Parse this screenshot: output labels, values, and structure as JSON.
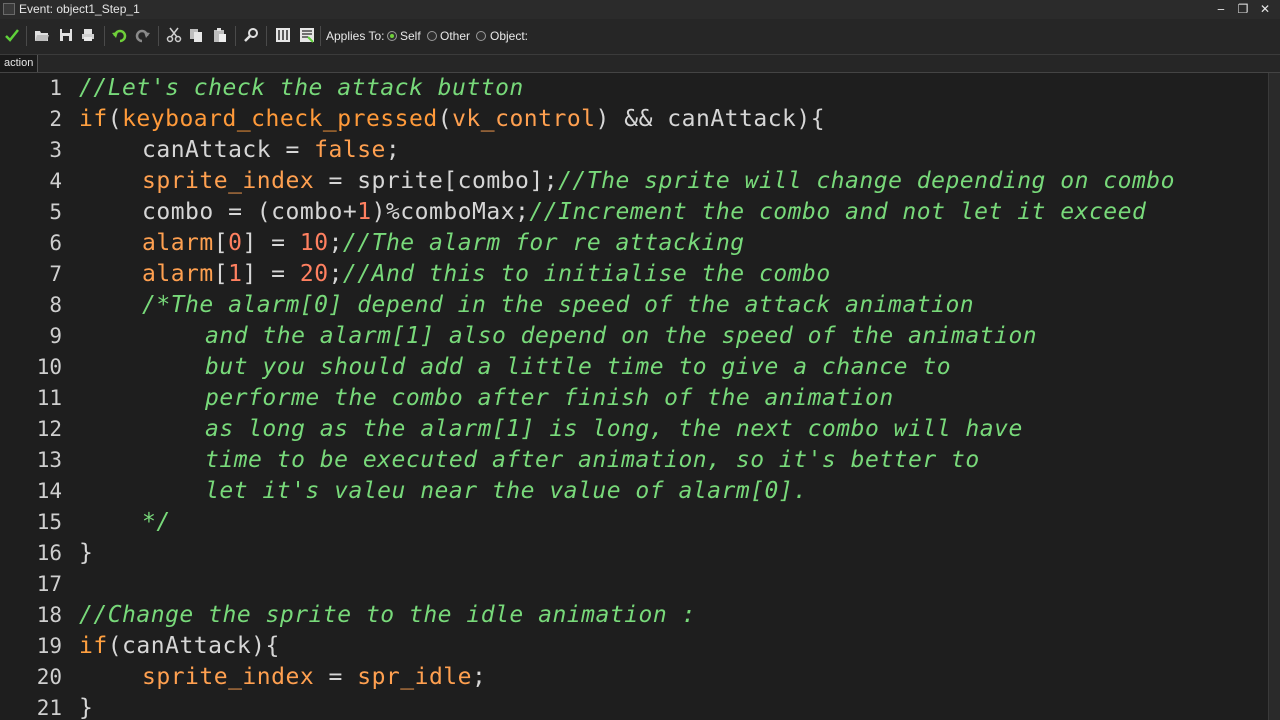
{
  "window": {
    "title": "Event: object1_Step_1",
    "controls": [
      "‒",
      "❐",
      "✕"
    ]
  },
  "toolbar": {
    "icons": [
      "check-icon",
      "open-icon",
      "save-icon",
      "print-icon",
      "undo-icon",
      "redo-icon",
      "cut-icon",
      "copy-icon",
      "paste-icon",
      "search-icon",
      "code-grid-icon",
      "script-icon"
    ],
    "applies_to_label": "Applies To:",
    "options": [
      {
        "label": "Self",
        "selected": true
      },
      {
        "label": "Other",
        "selected": false
      },
      {
        "label": "Object:",
        "selected": false
      }
    ]
  },
  "tabs": [
    {
      "label": "action"
    }
  ],
  "colors": {
    "background": "#1e1e1e",
    "comment": "#78d97a",
    "keyword": "#ffa040",
    "number": "#ff8060",
    "text": "#d6d6d6"
  },
  "code_lines": [
    {
      "num": "1",
      "indent": 0,
      "tokens": [
        {
          "t": "c",
          "s": "//Let's check the attack button"
        }
      ]
    },
    {
      "num": "2",
      "indent": 0,
      "tokens": [
        {
          "t": "k",
          "s": "if"
        },
        {
          "t": "p",
          "s": "("
        },
        {
          "t": "f",
          "s": "keyboard_check_pressed"
        },
        {
          "t": "p",
          "s": "("
        },
        {
          "t": "v",
          "s": "vk_control"
        },
        {
          "t": "p",
          "s": ") && canAttack){"
        }
      ]
    },
    {
      "num": "3",
      "indent": 1,
      "tokens": [
        {
          "t": "p",
          "s": "canAttack = "
        },
        {
          "t": "v",
          "s": "false"
        },
        {
          "t": "p",
          "s": ";"
        }
      ]
    },
    {
      "num": "4",
      "indent": 1,
      "tokens": [
        {
          "t": "v",
          "s": "sprite_index"
        },
        {
          "t": "p",
          "s": " = sprite[combo];"
        },
        {
          "t": "c",
          "s": "//The sprite will change depending on combo"
        }
      ]
    },
    {
      "num": "5",
      "indent": 1,
      "tokens": [
        {
          "t": "p",
          "s": "combo = (combo+"
        },
        {
          "t": "n",
          "s": "1"
        },
        {
          "t": "p",
          "s": ")%comboMax;"
        },
        {
          "t": "c",
          "s": "//Increment the combo and not let it exceed"
        }
      ]
    },
    {
      "num": "6",
      "indent": 1,
      "tokens": [
        {
          "t": "v",
          "s": "alarm"
        },
        {
          "t": "p",
          "s": "["
        },
        {
          "t": "n",
          "s": "0"
        },
        {
          "t": "p",
          "s": "] = "
        },
        {
          "t": "n",
          "s": "10"
        },
        {
          "t": "p",
          "s": ";"
        },
        {
          "t": "c",
          "s": "//The alarm for re attacking"
        }
      ]
    },
    {
      "num": "7",
      "indent": 1,
      "tokens": [
        {
          "t": "v",
          "s": "alarm"
        },
        {
          "t": "p",
          "s": "["
        },
        {
          "t": "n",
          "s": "1"
        },
        {
          "t": "p",
          "s": "] = "
        },
        {
          "t": "n",
          "s": "20"
        },
        {
          "t": "p",
          "s": ";"
        },
        {
          "t": "c",
          "s": "//And this to initialise the combo"
        }
      ]
    },
    {
      "num": "8",
      "indent": 1,
      "tokens": [
        {
          "t": "c",
          "s": "/*The alarm[0] depend in the speed of the attack animation"
        }
      ]
    },
    {
      "num": "9",
      "indent": 2,
      "tokens": [
        {
          "t": "c",
          "s": "and the alarm[1] also depend on the speed of the animation"
        }
      ]
    },
    {
      "num": "10",
      "indent": 2,
      "tokens": [
        {
          "t": "c",
          "s": "but you should add a little time to give a chance to"
        }
      ]
    },
    {
      "num": "11",
      "indent": 2,
      "tokens": [
        {
          "t": "c",
          "s": "performe the combo after finish of the animation"
        }
      ]
    },
    {
      "num": "12",
      "indent": 2,
      "tokens": [
        {
          "t": "c",
          "s": "as long as the alarm[1] is long, the next combo will have"
        }
      ]
    },
    {
      "num": "13",
      "indent": 2,
      "tokens": [
        {
          "t": "c",
          "s": "time to be executed after animation, so it's better to"
        }
      ]
    },
    {
      "num": "14",
      "indent": 2,
      "tokens": [
        {
          "t": "c",
          "s": "let it's valeu near the value of alarm[0]."
        }
      ]
    },
    {
      "num": "15",
      "indent": 1,
      "tokens": [
        {
          "t": "c",
          "s": "*/"
        }
      ]
    },
    {
      "num": "16",
      "indent": 0,
      "tokens": [
        {
          "t": "p",
          "s": "}"
        }
      ]
    },
    {
      "num": "17",
      "indent": 0,
      "tokens": []
    },
    {
      "num": "18",
      "indent": 0,
      "tokens": [
        {
          "t": "c",
          "s": "//Change the sprite to the idle animation :"
        }
      ]
    },
    {
      "num": "19",
      "indent": 0,
      "tokens": [
        {
          "t": "k",
          "s": "if"
        },
        {
          "t": "p",
          "s": "(canAttack){"
        }
      ]
    },
    {
      "num": "20",
      "indent": 1,
      "tokens": [
        {
          "t": "v",
          "s": "sprite_index"
        },
        {
          "t": "p",
          "s": " = "
        },
        {
          "t": "v",
          "s": "spr_idle"
        },
        {
          "t": "p",
          "s": ";"
        }
      ]
    },
    {
      "num": "21",
      "indent": 0,
      "tokens": [
        {
          "t": "p",
          "s": "}"
        }
      ]
    }
  ]
}
